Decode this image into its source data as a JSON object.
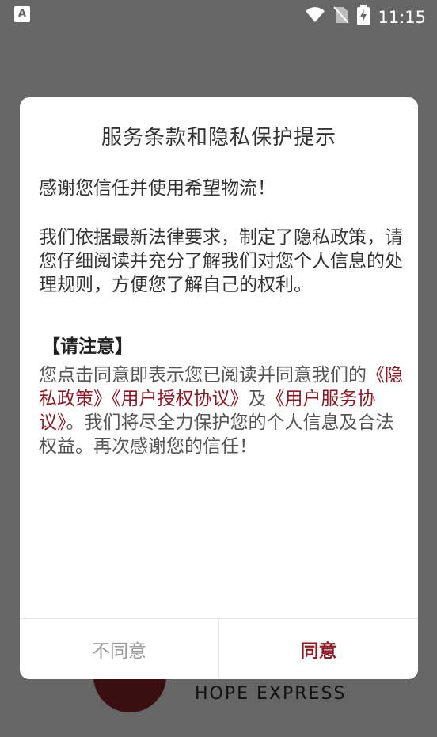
{
  "status_bar": {
    "notification_icon_letter": "A",
    "time": "11:15",
    "icons": [
      "wifi-icon",
      "no-sim-icon",
      "battery-charging-icon"
    ]
  },
  "background": {
    "logo_text": "HOPE EXPRESS"
  },
  "dialog": {
    "title": "服务条款和隐私保护提示",
    "thanks": "感谢您信任并使用希望物流！",
    "policy_text": "我们依据最新法律要求，制定了隐私政策，请您仔细阅读并充分了解我们对您个人信息的处理规则，方便您了解自己的权利。",
    "notice_title": "【请注意】",
    "notice_prefix": "您点击同意即表示您已阅读并同意我们的",
    "link_privacy": "《隐私政策》",
    "link_auth": "《用户授权协议》",
    "conjunction": "及",
    "link_service": "《用户服务协议》",
    "notice_suffix": "。我们将尽全力保护您的个人信息及合法权益。再次感谢您的信任！",
    "decline_label": "不同意",
    "agree_label": "同意"
  },
  "colors": {
    "accent": "#8b1a25",
    "overlay": "#666666"
  }
}
